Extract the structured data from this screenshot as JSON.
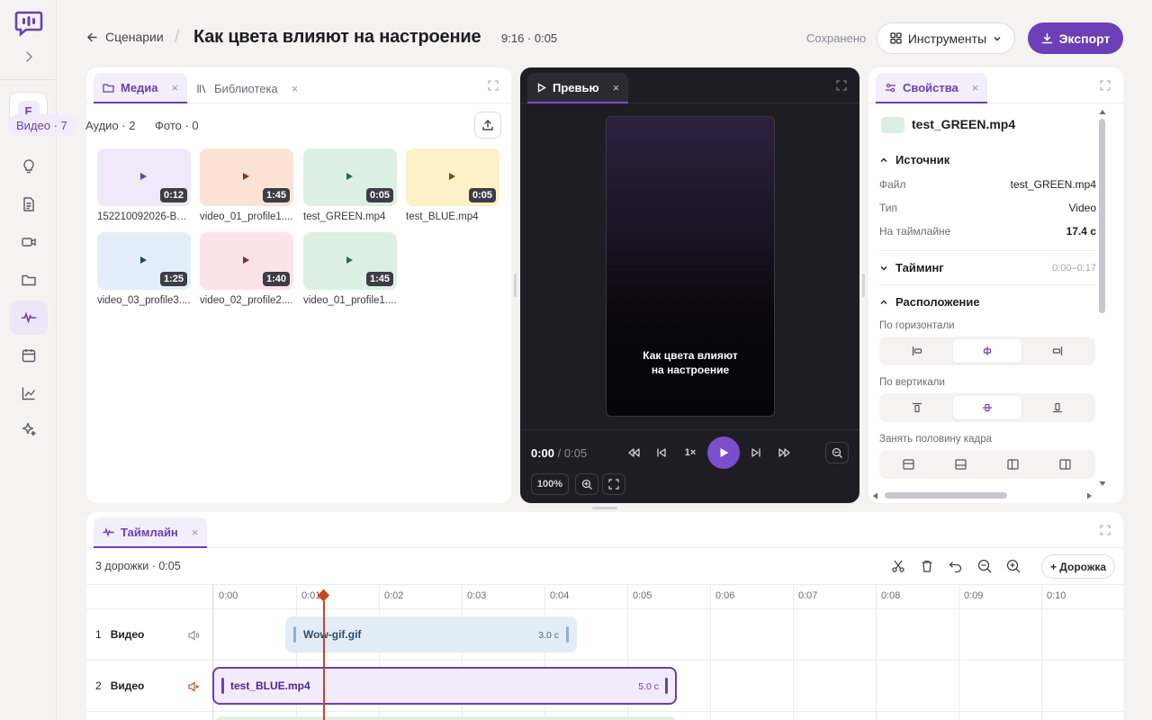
{
  "header": {
    "back_label": "Сценарии",
    "title": "Как цвета влияют на настроение",
    "meta": "9:16 · 0:05",
    "saved": "Сохранено",
    "tools_label": "Инструменты",
    "export_label": "Экспорт"
  },
  "rail": {
    "workspace_initial": "F",
    "items": [
      "lightbulb-icon",
      "document-icon",
      "video-camera-icon",
      "folder-icon",
      "waveform-icon",
      "calendar-icon",
      "chart-icon",
      "sparkle-icon"
    ],
    "active_item": "waveform-icon"
  },
  "media": {
    "tab_media": "Медиа",
    "tab_library": "Библиотека",
    "chip_video": "Видео · 7",
    "chip_audio": "Аудио · 2",
    "chip_photo": "Фото · 0",
    "items": [
      {
        "name": "152210092026-Ви...",
        "duration": "0:12",
        "bg": "#efe9fa",
        "accent": "#6b3fb5"
      },
      {
        "name": "video_01_profile1....",
        "duration": "1:45",
        "bg": "#fde3d6",
        "accent": "#8a3a14"
      },
      {
        "name": "test_GREEN.mp4",
        "duration": "0:05",
        "bg": "#dcefe4",
        "accent": "#2a6a45"
      },
      {
        "name": "test_BLUE.mp4",
        "duration": "0:05",
        "bg": "#fdf1c7",
        "accent": "#6b5410"
      },
      {
        "name": "video_03_profile3....",
        "duration": "1:25",
        "bg": "#e3eefa",
        "accent": "#24466e"
      },
      {
        "name": "video_02_profile2....",
        "duration": "1:40",
        "bg": "#fce3ea",
        "accent": "#8a2443"
      },
      {
        "name": "video_01_profile1....",
        "duration": "1:45",
        "bg": "#dcefe4",
        "accent": "#2a6a45"
      }
    ]
  },
  "preview": {
    "tab_label": "Превью",
    "caption_line1": "Как цвета влияют",
    "caption_line2": "на настроение",
    "time_current": "0:00",
    "time_total": "/ 0:05",
    "speed": "1×",
    "zoom": "100%"
  },
  "props": {
    "tab_label": "Свойства",
    "file_title": "test_GREEN.mp4",
    "source_header": "Источник",
    "file_label": "Файл",
    "file_value": "test_GREEN.mp4",
    "type_label": "Тип",
    "type_value": "Video",
    "on_timeline_label": "На таймлайне",
    "on_timeline_value": "17.4 с",
    "timing_header": "Тайминг",
    "timing_value": "0:00–0:17",
    "layout_header": "Расположение",
    "horizontal_label": "По горизонтали",
    "vertical_label": "По вертикали",
    "half_label": "Занять половину кадра"
  },
  "timeline": {
    "tab_label": "Таймлайн",
    "summary": "3 дорожки · 0:05",
    "add_track": "+ Дорожка",
    "ticks": [
      "0:00",
      "0:01",
      "0:02",
      "0:03",
      "0:04",
      "0:05",
      "0:06",
      "0:07",
      "0:08",
      "0:09",
      "0:10"
    ],
    "playhead_time": 1.33,
    "tracks": [
      {
        "index": "1",
        "name": "Видео",
        "muted": false
      },
      {
        "index": "2",
        "name": "Видео",
        "muted": true
      }
    ],
    "clips": [
      {
        "name": "Wow-gif.gif",
        "duration": "3.0 с"
      },
      {
        "name": "test_BLUE.mp4",
        "duration": "5.0 с"
      }
    ]
  },
  "colors": {
    "accent": "#6b3fb5",
    "playhead": "#c8441f"
  }
}
